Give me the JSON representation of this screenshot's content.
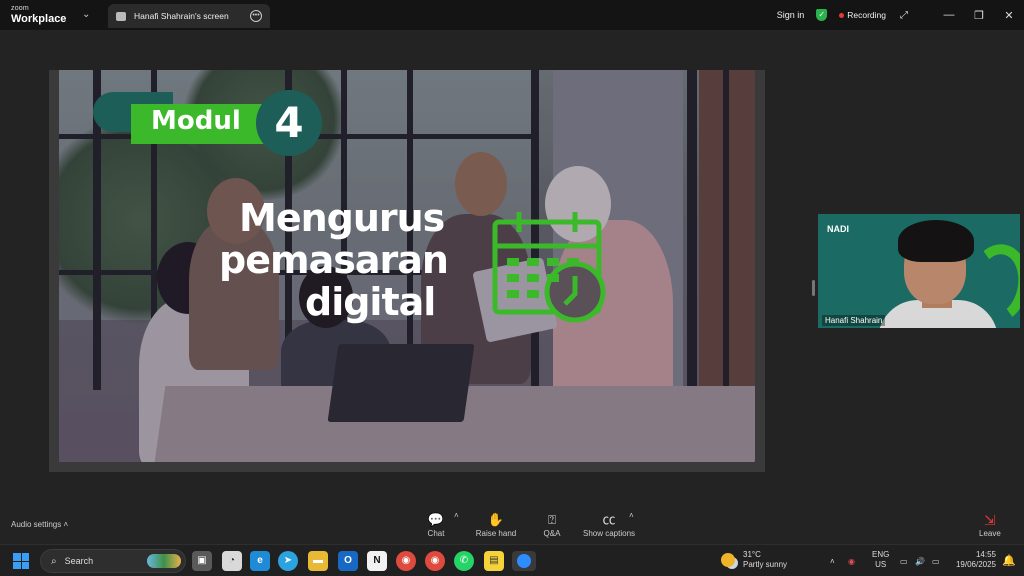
{
  "app": {
    "brand_top": "zoom",
    "brand_bottom": "Workplace",
    "tab_title": "Hanafi Shahrain's screen",
    "sign_in": "Sign in",
    "recording": "Recording"
  },
  "slide": {
    "modul_label": "Modul",
    "modul_number": "4",
    "title_lines": [
      "Mengurus",
      "pemasaran",
      "digital"
    ],
    "accent_color": "#3cb92a",
    "teal_color": "#1e5e59"
  },
  "participant": {
    "logo_text": "NADI",
    "name": "Hanafi Shahrain"
  },
  "toolbar": {
    "audio_settings": "Audio settings",
    "chat": "Chat",
    "raise_hand": "Raise hand",
    "qa": "Q&A",
    "show_captions": "Show captions",
    "leave": "Leave"
  },
  "taskbar": {
    "search_placeholder": "Search",
    "weather_temp": "31°C",
    "weather_desc": "Partly sunny",
    "lang_top": "ENG",
    "lang_bottom": "US",
    "time": "14:55",
    "date": "19/06/2025"
  }
}
